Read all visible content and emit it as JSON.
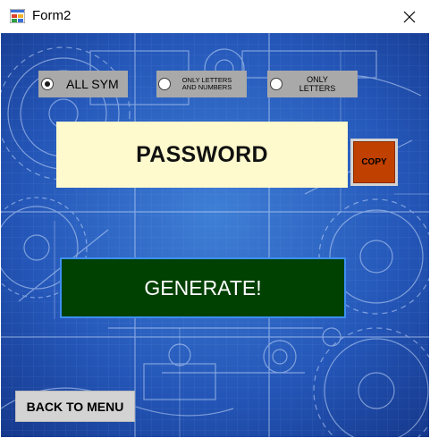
{
  "window": {
    "title": "Form2",
    "close_glyph": "✕",
    "icon": "app-form-icon"
  },
  "options": [
    {
      "label": "ALL SYM",
      "checked": true
    },
    {
      "label_line1": "ONLY LETTERS",
      "label_line2": "AND NUMBERS",
      "checked": false
    },
    {
      "label_line1": "ONLY",
      "label_line2": "LETTERS",
      "checked": false
    }
  ],
  "password": {
    "text": "PASSWORD"
  },
  "buttons": {
    "copy": "COPY",
    "generate": "GENERATE!",
    "back": "BACK TO MENU"
  },
  "colors": {
    "background": "#1f54b3",
    "password_bg": "#fffacd",
    "copy_bg": "#c04000",
    "generate_bg": "#004000",
    "option_bg": "#a9a9a9",
    "back_bg": "#d3d3d3"
  }
}
